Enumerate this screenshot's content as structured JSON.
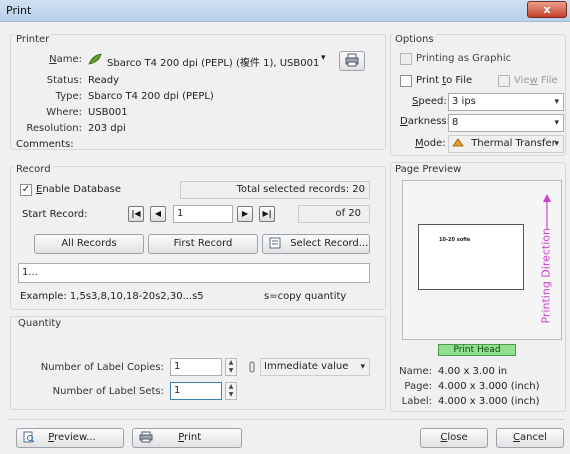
{
  "window": {
    "title": "Print",
    "close_glyph": "x"
  },
  "printer": {
    "group_label": "Printer",
    "name_label": "Name:",
    "name_value": "Sbarco T4 200 dpi (PEPL) (複件 1), USB001",
    "status_label": "Status:",
    "status_value": "Ready",
    "type_label": "Type:",
    "type_value": "Sbarco T4 200 dpi (PEPL)",
    "where_label": "Where:",
    "where_value": "USB001",
    "resolution_label": "Resolution:",
    "resolution_value": "203 dpi",
    "comments_label": "Comments:",
    "comments_value": ""
  },
  "options": {
    "group_label": "Options",
    "printing_as_graphic": "Printing as Graphic",
    "print_to_file": "Print to File",
    "view_file": "View File",
    "speed_label": "Speed:",
    "speed_value": "3 ips",
    "darkness_label": "Darkness:",
    "darkness_value": "8",
    "mode_label": "Mode:",
    "mode_value": "Thermal Transfer"
  },
  "record": {
    "group_label": "Record",
    "enable_database": "Enable Database",
    "enable_database_checked": true,
    "total_selected": "Total selected records: 20",
    "start_record_label": "Start Record:",
    "start_record_value": "1",
    "of_total": "of 20",
    "all_records": "All Records",
    "first_record": "First Record",
    "select_record": "Select Record...",
    "range_value": "1...",
    "example": "Example: 1,5s3,8,10,18-20s2,30...s5",
    "copy_hint": "s=copy quantity"
  },
  "quantity": {
    "group_label": "Quantity",
    "copies_label": "Number of Label Copies:",
    "copies_value": "1",
    "copies_mode": "Immediate value",
    "sets_label": "Number of Label Sets:",
    "sets_value": "1"
  },
  "preview": {
    "group_label": "Page Preview",
    "direction_text": "Printing Direction",
    "print_head": "Print Head",
    "label_sample_text": "10-20 sofie",
    "name_label": "Name:",
    "name_value": "4.00 x 3.00 in",
    "page_label": "Page:",
    "page_value": "4.000 x 3.000 (inch)",
    "label_label": "Label:",
    "label_value": "4.000 x 3.000 (inch)"
  },
  "footer": {
    "preview_button": "Preview...",
    "print_button": "Print",
    "close_button": "Close",
    "cancel_button": "Cancel"
  },
  "colors": {
    "direction_magenta": "#d23fd2",
    "print_head_green": "#8fe08f"
  }
}
